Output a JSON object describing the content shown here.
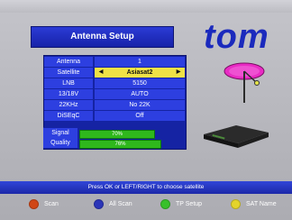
{
  "title": "Antenna Setup",
  "brand": "tom",
  "settings": [
    {
      "label": "Antenna",
      "value": "1"
    },
    {
      "label": "Satellite",
      "value": "Asiasat2",
      "selected": true
    },
    {
      "label": "LNB",
      "value": "5150"
    },
    {
      "label": "13/18V",
      "value": "AUTO"
    },
    {
      "label": "22KHz",
      "value": "No 22K"
    },
    {
      "label": "DiSEqC",
      "value": "Off"
    }
  ],
  "signal": {
    "label": "Signal",
    "text": "70%",
    "level": 0.7
  },
  "quality": {
    "label": "Quality",
    "text": "76%",
    "level": 0.76
  },
  "footer": {
    "hint": "Press OK or LEFT/RIGHT to choose satellite"
  },
  "legend": [
    {
      "label": "Scan",
      "color": "#d04616"
    },
    {
      "label": "All Scan",
      "color": "#2b35b8"
    },
    {
      "label": "TP Setup",
      "color": "#38c12a"
    },
    {
      "label": "SAT Name",
      "color": "#e4d42b"
    }
  ],
  "icons": {
    "left": "left-arrow-icon",
    "right": "right-arrow-icon"
  }
}
